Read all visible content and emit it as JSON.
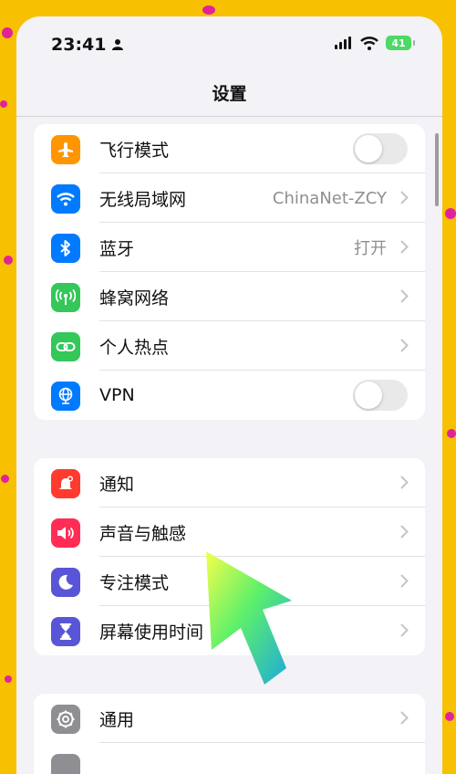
{
  "status_bar": {
    "time": "23:41",
    "battery": "41"
  },
  "nav": {
    "title": "设置"
  },
  "groups": [
    {
      "rows": [
        {
          "label": "飞行模式",
          "value": "",
          "icon": "airplane-icon",
          "color": "#ff9500",
          "control": "toggle",
          "on": false
        },
        {
          "label": "无线局域网",
          "value": "ChinaNet-ZCY",
          "icon": "wifi-icon",
          "color": "#007aff",
          "control": "chevron"
        },
        {
          "label": "蓝牙",
          "value": "打开",
          "icon": "bluetooth-icon",
          "color": "#007aff",
          "control": "chevron"
        },
        {
          "label": "蜂窝网络",
          "value": "",
          "icon": "antenna-icon",
          "color": "#34c759",
          "control": "chevron"
        },
        {
          "label": "个人热点",
          "value": "",
          "icon": "link-icon",
          "color": "#34c759",
          "control": "chevron"
        },
        {
          "label": "VPN",
          "value": "",
          "icon": "globe-icon",
          "color": "#007aff",
          "control": "toggle",
          "on": false
        }
      ]
    },
    {
      "rows": [
        {
          "label": "通知",
          "value": "",
          "icon": "notification-bell-icon",
          "color": "#ff3b30",
          "control": "chevron"
        },
        {
          "label": "声音与触感",
          "value": "",
          "icon": "speaker-icon",
          "color": "#ff2d55",
          "control": "chevron"
        },
        {
          "label": "专注模式",
          "value": "",
          "icon": "moon-icon",
          "color": "#5856d6",
          "control": "chevron"
        },
        {
          "label": "屏幕使用时间",
          "value": "",
          "icon": "hourglass-icon",
          "color": "#5856d6",
          "control": "chevron"
        }
      ]
    },
    {
      "rows": [
        {
          "label": "通用",
          "value": "",
          "icon": "gear-icon",
          "color": "#8e8e93",
          "control": "chevron"
        }
      ]
    }
  ],
  "overlay": {
    "arrow_color": "green-blue gradient"
  }
}
